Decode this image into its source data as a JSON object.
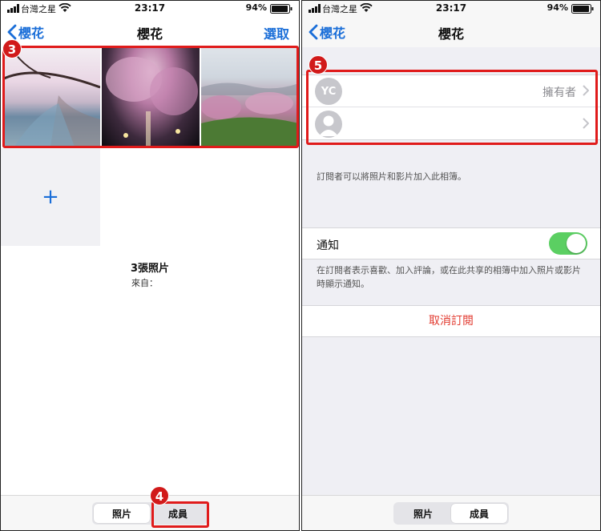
{
  "status_bar": {
    "carrier": "台灣之星",
    "time": "23:17",
    "battery": "94%"
  },
  "left": {
    "nav": {
      "back_label": "櫻花",
      "title": "櫻花",
      "action_label": "選取"
    },
    "add_label": "+",
    "photo_count": "3張照片",
    "from_label": "來自：",
    "tabs": [
      {
        "label": "照片",
        "active": true
      },
      {
        "label": "成員",
        "active": false
      }
    ],
    "badges": {
      "photos": "3",
      "members_tab": "4"
    }
  },
  "right": {
    "nav": {
      "back_label": "櫻花",
      "title": "櫻花"
    },
    "members": [
      {
        "initials": "YC",
        "role": "擁有者"
      },
      {
        "initials": "",
        "role": ""
      }
    ],
    "subscriber_note": "訂閱者可以將照片和影片加入此相簿。",
    "notify_label": "通知",
    "notify_on": true,
    "notify_note": "在訂閱者表示喜歡、加入評論，或在此共享的相簿中加入照片或影片時顯示通知。",
    "unsubscribe_label": "取消訂閱",
    "tabs": [
      {
        "label": "照片",
        "active": false
      },
      {
        "label": "成員",
        "active": true
      }
    ],
    "badge": "5"
  },
  "colors": {
    "accent": "#1a6ed8",
    "highlight": "#e01b1b",
    "toggle_on": "#5bcf62",
    "destructive": "#e23b30"
  }
}
